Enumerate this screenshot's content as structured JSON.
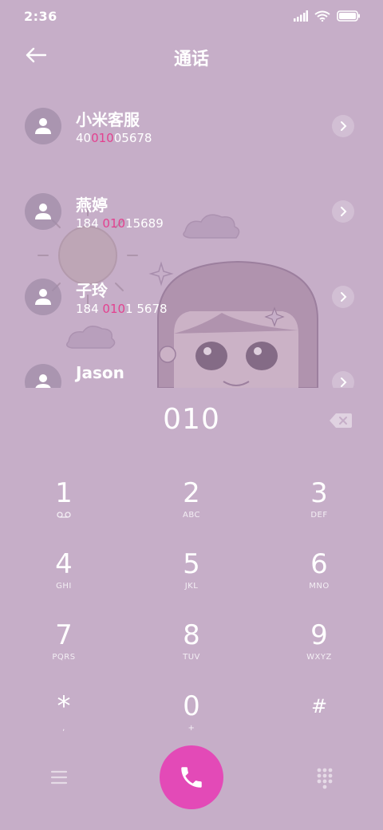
{
  "status_bar": {
    "time": "2:36",
    "icons": [
      "signal-icon",
      "wifi-icon",
      "battery-icon"
    ]
  },
  "header": {
    "title": "通话",
    "back_icon": "arrow-left-icon"
  },
  "contacts": [
    {
      "name": "小米客服",
      "number_pre": "40",
      "number_match": "010",
      "number_post": "05678"
    },
    {
      "name": "燕婷",
      "number_pre": "184 ",
      "number_match": "010",
      "number_post": "15689"
    },
    {
      "name": "子玲",
      "number_pre": "184 ",
      "number_match": "010",
      "number_post": "1 5678"
    },
    {
      "name": "Jason",
      "number_pre": "",
      "number_match": "",
      "number_post": ""
    }
  ],
  "dialer": {
    "input": "010"
  },
  "keypad": [
    {
      "digit": "1",
      "letters": ""
    },
    {
      "digit": "2",
      "letters": "ABC"
    },
    {
      "digit": "3",
      "letters": "DEF"
    },
    {
      "digit": "4",
      "letters": "GHI"
    },
    {
      "digit": "5",
      "letters": "JKL"
    },
    {
      "digit": "6",
      "letters": "MNO"
    },
    {
      "digit": "7",
      "letters": "PQRS"
    },
    {
      "digit": "8",
      "letters": "TUV"
    },
    {
      "digit": "9",
      "letters": "WXYZ"
    },
    {
      "digit": "*",
      "letters": ","
    },
    {
      "digit": "0",
      "letters": "+"
    },
    {
      "digit": "#",
      "letters": ""
    }
  ],
  "colors": {
    "background": "#c6aec8",
    "accent": "#e3418f",
    "call_button": "#e34ab7"
  }
}
